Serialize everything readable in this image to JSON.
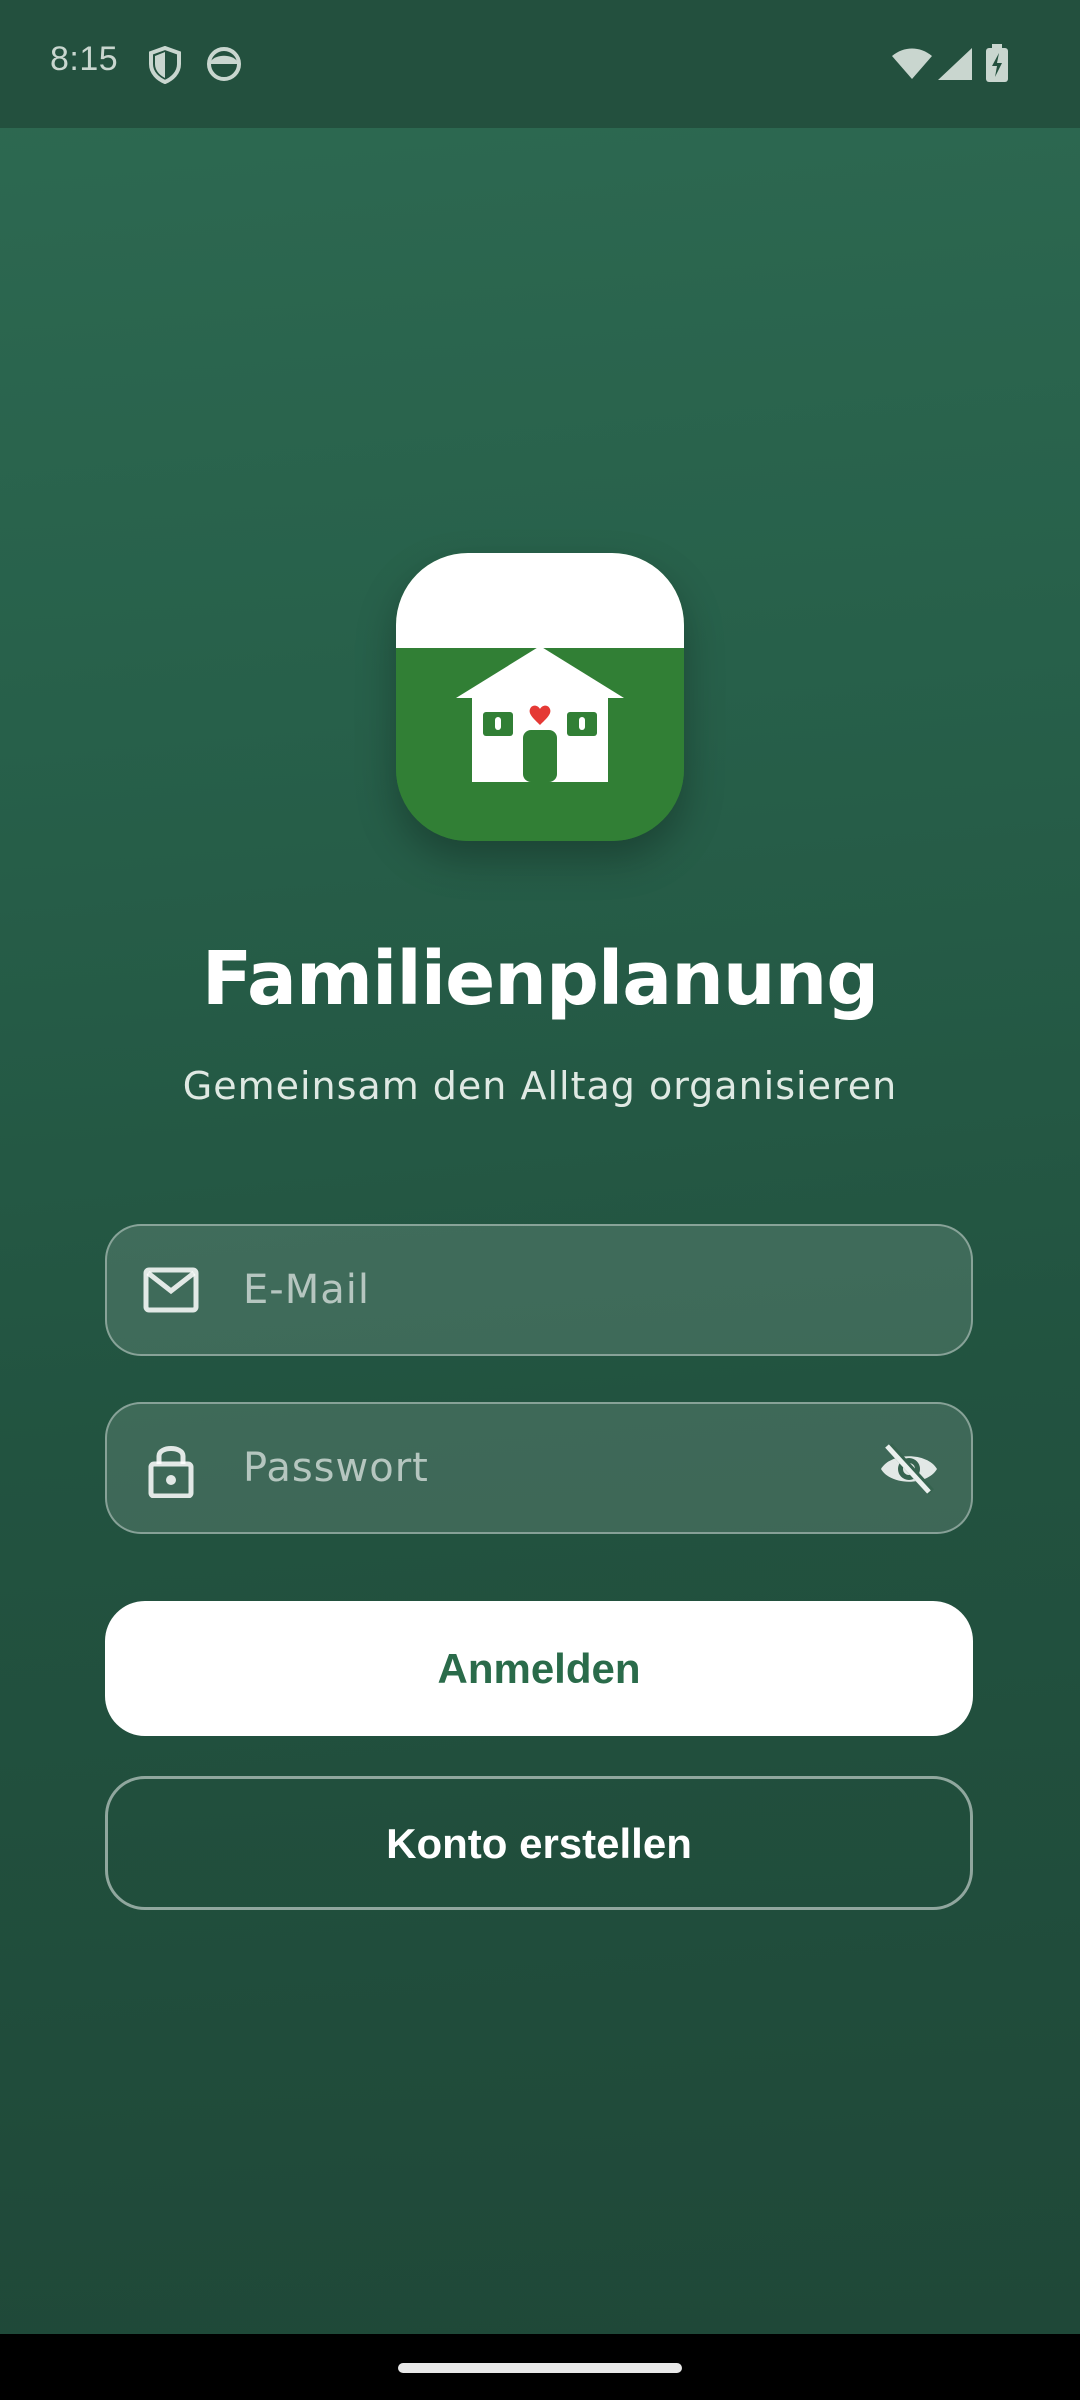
{
  "status_bar": {
    "time": "8:15",
    "icons": [
      "shield-icon",
      "face-icon",
      "wifi-icon",
      "signal-icon",
      "battery-charging-icon"
    ]
  },
  "app": {
    "logo_icon": "house-heart-icon",
    "title": "Familienplanung",
    "subtitle": "Gemeinsam den Alltag organisieren"
  },
  "form": {
    "email": {
      "placeholder": "E-Mail",
      "value": "",
      "icon": "mail-icon"
    },
    "password": {
      "placeholder": "Passwort",
      "value": "",
      "icon": "lock-icon",
      "toggle_icon": "eye-off-icon"
    }
  },
  "buttons": {
    "login_label": "Anmelden",
    "register_label": "Konto erstellen"
  },
  "colors": {
    "background_top": "#2e6a52",
    "background_bottom": "#1f4838",
    "primary_text": "#2a6b4a",
    "logo_green": "#317f35",
    "heart": "#e53935"
  }
}
